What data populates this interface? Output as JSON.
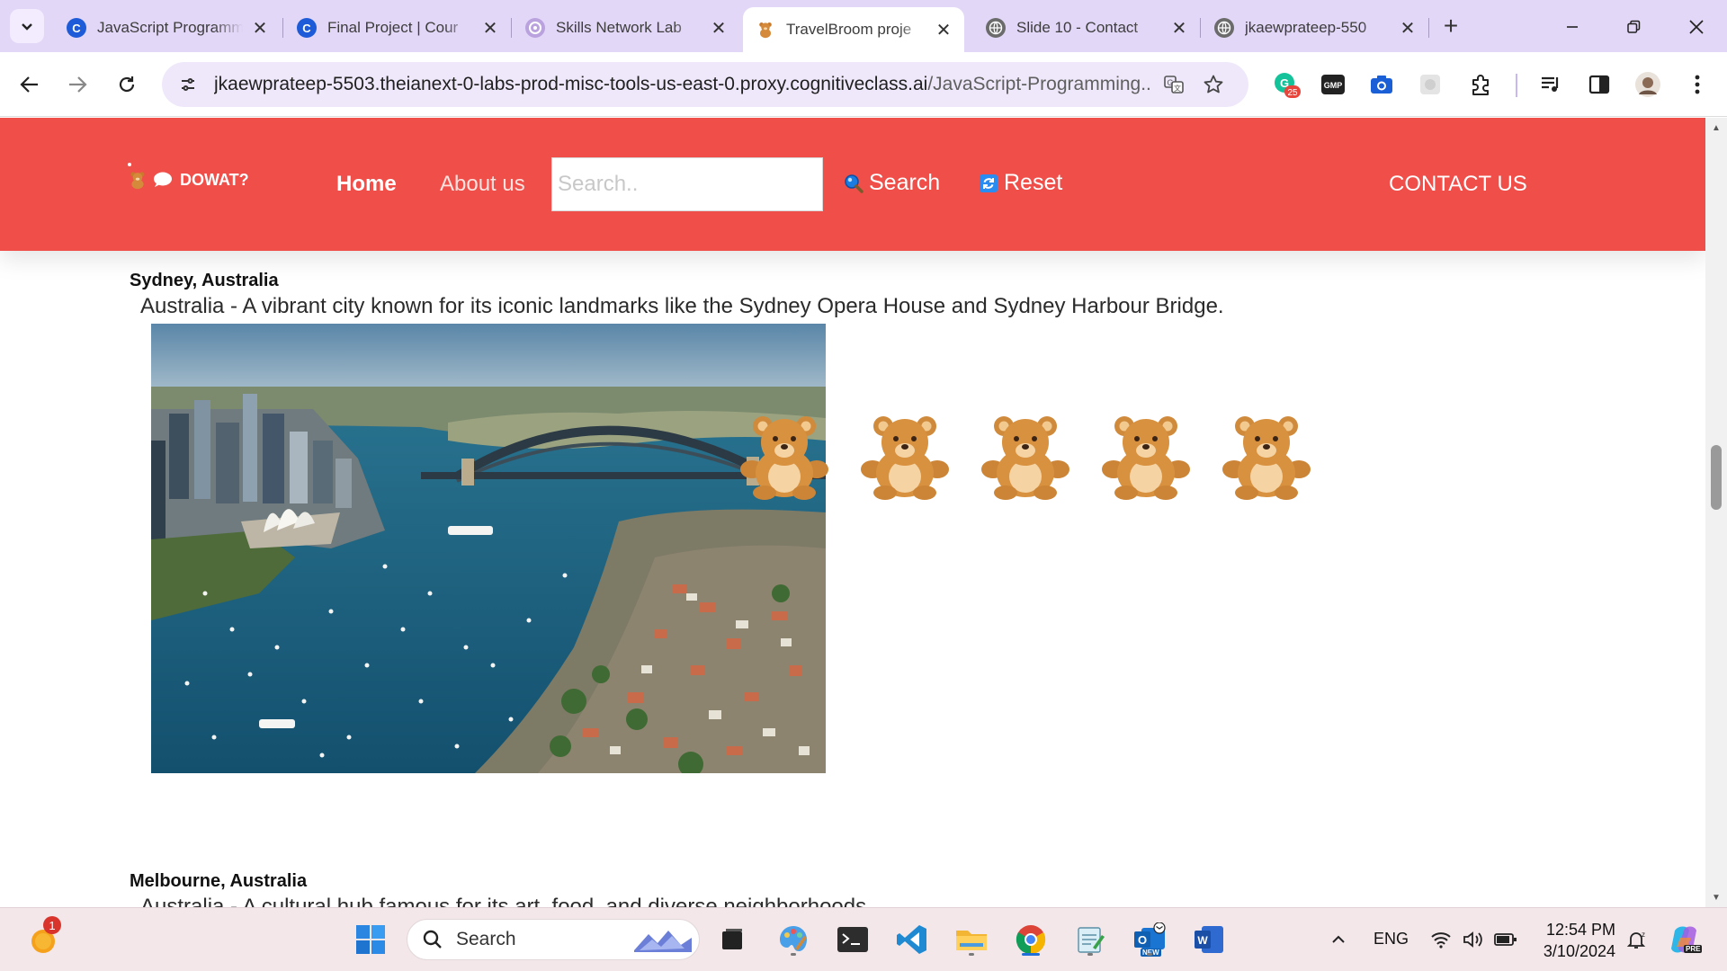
{
  "browser": {
    "tabs": [
      {
        "title": "JavaScript Programm",
        "icon": "coursera-icon",
        "active": false
      },
      {
        "title": "Final Project | Cour",
        "icon": "coursera-icon",
        "active": false
      },
      {
        "title": "Skills Network Lab",
        "icon": "skills-network-icon",
        "active": false
      },
      {
        "title": "TravelBroom proje",
        "icon": "teddy-bear-icon",
        "active": true
      },
      {
        "title": "Slide 10 - Contact",
        "icon": "globe-icon",
        "active": false
      },
      {
        "title": "jkaewprateep-550",
        "icon": "globe-icon",
        "active": false
      }
    ],
    "url_host": "jkaewprateep-5503.theianext-0-labs-prod-misc-tools-us-east-0.proxy.cognitiveclass.ai",
    "url_path": "/JavaScript-Programming...",
    "extension_badge": "25",
    "colors": {
      "tabstrip": "#e3d7f8",
      "omnibox": "#efe8fa"
    }
  },
  "site": {
    "logo_text": "DOWAT?",
    "nav_home": "Home",
    "nav_about": "About us",
    "search_placeholder": "Search..",
    "search_button": "Search",
    "reset_button": "Reset",
    "contact": "CONTACT US",
    "header_color": "#ef4e49"
  },
  "entries": [
    {
      "title": "Sydney, Australia",
      "description": "Australia - A vibrant city known for its iconic landmarks like the Sydney Opera House and Sydney Harbour Bridge.",
      "image": "sydney-harbour-photo",
      "icons": [
        "teddy-bear-icon",
        "teddy-bear-icon",
        "teddy-bear-icon",
        "teddy-bear-icon",
        "teddy-bear-icon"
      ]
    },
    {
      "title": "Melbourne, Australia",
      "description": "Australia - A cultural hub famous for its art, food, and diverse neighborhoods."
    }
  ],
  "taskbar": {
    "search_label": "Search",
    "notification_count": "1",
    "language": "ENG",
    "time": "12:54 PM",
    "date": "3/10/2024",
    "outlook_badge": "NEW",
    "copilot_badge": "PRE"
  }
}
